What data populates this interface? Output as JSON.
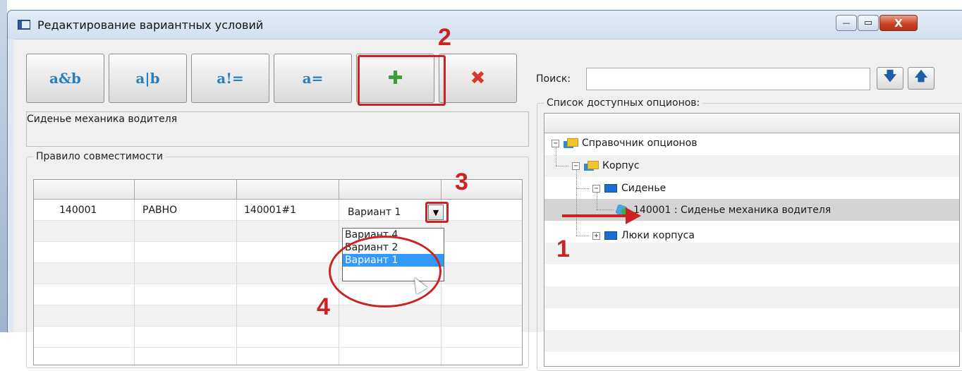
{
  "window": {
    "title": "Редактирование вариантных условий",
    "min_glyph": "—",
    "max_glyph": "▭",
    "close_glyph": "X"
  },
  "toolbar": {
    "and_label": "a&b",
    "or_label": "a|b",
    "neq_label": "a!=",
    "eq_label": "a=",
    "add_glyph": "✚",
    "delete_glyph": "✖"
  },
  "description": "Сиденье механика водителя",
  "rule_group": {
    "label": "Правило совместимости",
    "row": {
      "code": "140001",
      "operator": "РАВНО",
      "value": "140001#1",
      "variant": "Вариант 1"
    },
    "dropdown_options": [
      "Вариант 4",
      "Вариант 2",
      "Вариант 1"
    ],
    "selected_option": "Вариант 1"
  },
  "search": {
    "label": "Поиск:",
    "value": "",
    "down_glyph": "🡇",
    "up_glyph": "🡅"
  },
  "options_group": {
    "label": "Список доступных опционов:",
    "tree": {
      "root": "Справочник опционов",
      "level1": "Корпус",
      "level2": "Сиденье",
      "leaf_selected": "140001 : Сиденье механика водителя",
      "level2_b": "Люки корпуса"
    }
  },
  "annotations": {
    "n1": "1",
    "n2": "2",
    "n3": "3",
    "n4": "4",
    "accent": "#cc2222"
  }
}
